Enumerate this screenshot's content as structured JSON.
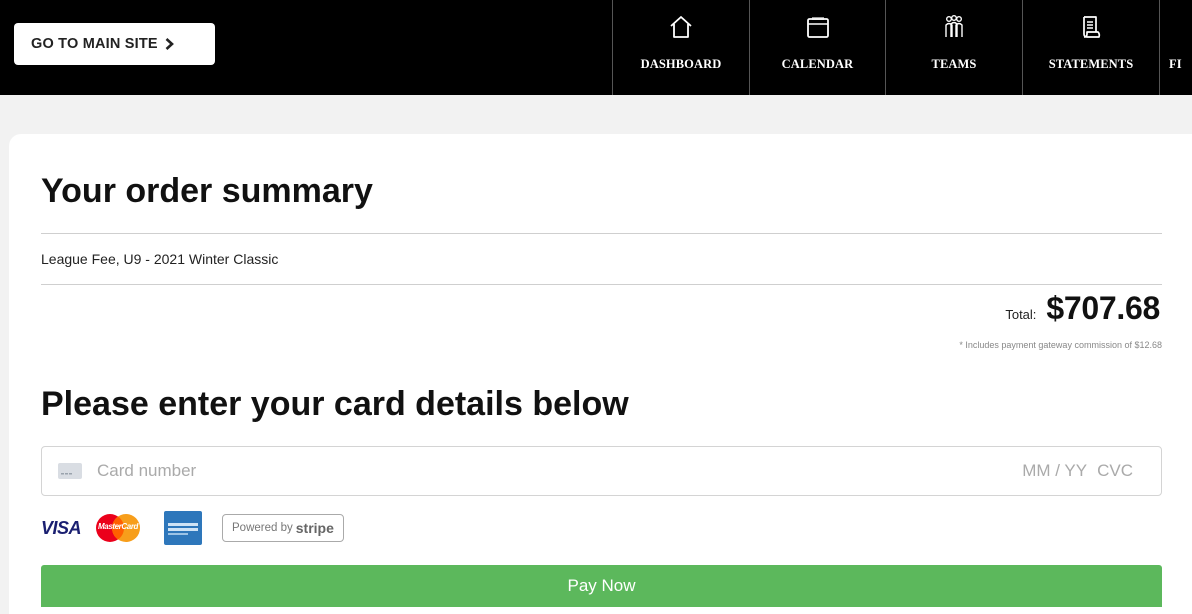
{
  "header": {
    "main_site_label": "GO TO MAIN SITE",
    "nav": [
      {
        "label": "DASHBOARD",
        "icon": "home-icon"
      },
      {
        "label": "CALENDAR",
        "icon": "calendar-icon"
      },
      {
        "label": "TEAMS",
        "icon": "teams-icon"
      },
      {
        "label": "STATEMENTS",
        "icon": "statement-icon"
      },
      {
        "label": "FI",
        "icon": ""
      }
    ]
  },
  "order": {
    "title": "Your order summary",
    "line_item": "League Fee, U9 - 2021 Winter Classic",
    "total_label": "Total:",
    "total_value": "$707.68",
    "commission_note": "* Includes payment gateway commission of $12.68"
  },
  "payment": {
    "title": "Please enter your card details below",
    "card_placeholder": "Card number",
    "expiry_placeholder": "MM / YY",
    "cvc_placeholder": "CVC",
    "brands": {
      "visa": "VISA",
      "mastercard": "MasterCard"
    },
    "stripe_badge_prefix": "Powered by",
    "stripe_badge_brand": "stripe",
    "pay_button": "Pay Now"
  },
  "colors": {
    "header_bg": "#000000",
    "pay_button": "#5cb85c",
    "visa_blue": "#1a1f71",
    "amex_blue": "#2e77bb"
  }
}
